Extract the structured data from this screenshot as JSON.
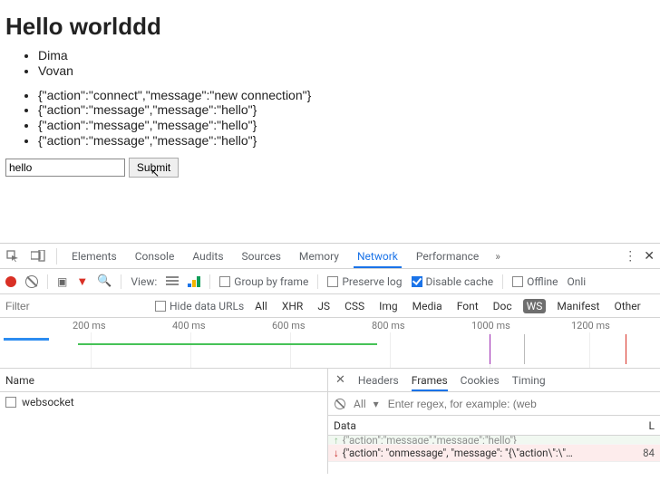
{
  "page": {
    "heading": "Hello worlddd",
    "users": [
      "Dima",
      "Vovan"
    ],
    "messages": [
      "{\"action\":\"connect\",\"message\":\"new connection\"}",
      "{\"action\":\"message\",\"message\":\"hello\"}",
      "{\"action\":\"message\",\"message\":\"hello\"}",
      "{\"action\":\"message\",\"message\":\"hello\"}"
    ],
    "input_value": "hello",
    "submit_label": "Submit"
  },
  "devtools": {
    "tabs": {
      "elements": "Elements",
      "console": "Console",
      "audits": "Audits",
      "sources": "Sources",
      "memory": "Memory",
      "network": "Network",
      "performance": "Performance"
    },
    "toolbar": {
      "view_label": "View:",
      "group_by_frame": "Group by frame",
      "preserve_log": "Preserve log",
      "disable_cache": "Disable cache",
      "offline": "Offline",
      "online": "Onli"
    },
    "filterbar": {
      "filter_placeholder": "Filter",
      "hide_data_urls": "Hide data URLs",
      "types": {
        "all": "All",
        "xhr": "XHR",
        "js": "JS",
        "css": "CSS",
        "img": "Img",
        "media": "Media",
        "font": "Font",
        "doc": "Doc",
        "ws": "WS",
        "manifest": "Manifest",
        "other": "Other"
      }
    },
    "timeline": {
      "ticks": [
        "200 ms",
        "400 ms",
        "600 ms",
        "800 ms",
        "1000 ms",
        "1200 ms"
      ]
    },
    "left": {
      "header": "Name",
      "item": "websocket"
    },
    "right": {
      "tabs": {
        "headers": "Headers",
        "frames": "Frames",
        "cookies": "Cookies",
        "timing": "Timing"
      },
      "opts": {
        "all": "All",
        "regex_placeholder": "Enter regex, for example: (web"
      },
      "table": {
        "data_header": "Data",
        "len_header": "L",
        "rows": [
          {
            "dir": "up",
            "text": "{\"action\":\"message\",\"message\":\"hello\"}",
            "len": ""
          },
          {
            "dir": "down",
            "text": "{\"action\": \"onmessage\", \"message\": \"{\\\"action\\\":\\\"…",
            "len": "84"
          }
        ]
      }
    }
  }
}
